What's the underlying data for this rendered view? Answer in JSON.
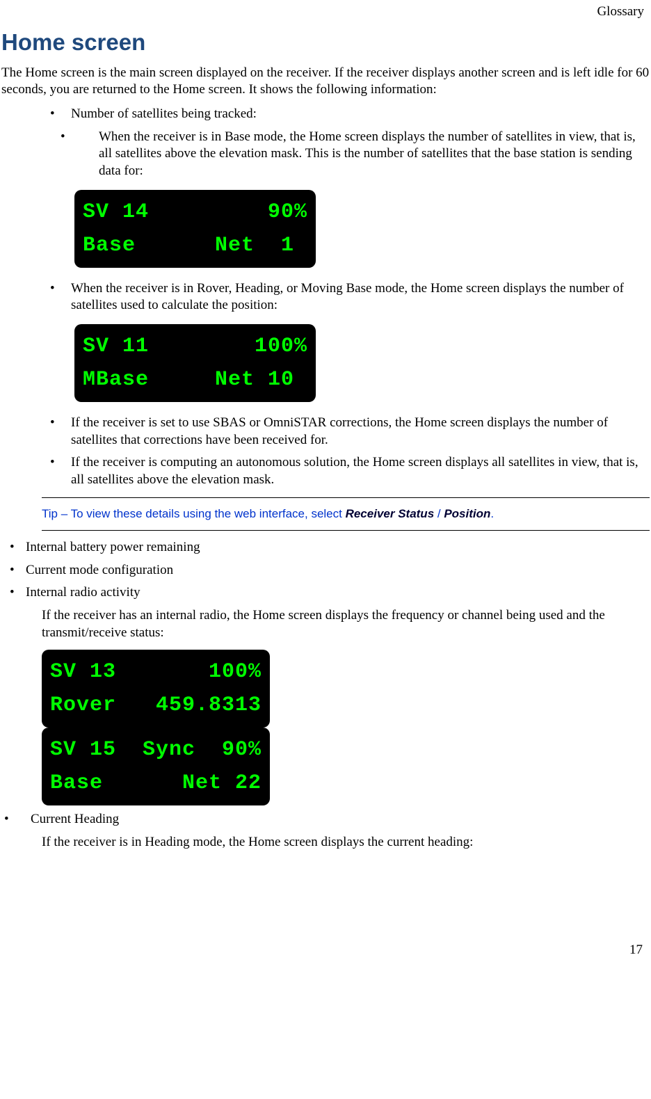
{
  "header": {
    "right": "Glossary"
  },
  "title": "Home screen",
  "intro": "The Home screen is the main screen displayed on the receiver. If the receiver displays another screen and is left idle for 60 seconds, you are returned to the Home screen. It shows the following information:",
  "bullet1": "Number of satellites being tracked:",
  "bullet1a": "When the receiver is in Base mode, the Home screen displays the number of satellites in view, that is, all satellites above the elevation mask. This is the number of satellites that the base station is sending data for:",
  "lcd1_line1": "SV 14         90%",
  "lcd1_line2": "Base      Net  1",
  "bullet2": "When the receiver is in Rover, Heading, or Moving Base mode, the Home screen displays the number of satellites used to calculate the position:",
  "lcd2_line1": "SV 11        100%",
  "lcd2_line2": "MBase     Net 10",
  "bullet3": "If the receiver is set to use SBAS or OmniSTAR corrections, the Home screen displays the number of satellites that corrections have been received for.",
  "bullet4": "If the receiver is computing an autonomous solution, the Home screen displays all satellites in view, that is, all satellites above the elevation mask.",
  "tip_prefix": "Tip – To view these details using the web interface, select ",
  "tip_b1": "Receiver Status",
  "tip_mid": " / ",
  "tip_b2": "Position",
  "tip_suffix": ".",
  "bullet5": "Internal battery power remaining",
  "bullet6": "Current mode configuration",
  "bullet7": "Internal radio activity",
  "radio_text": "If the receiver has an internal radio, the Home screen displays the frequency or channel being used and the transmit/receive status:",
  "lcd3a_line1": "SV 13       100%",
  "lcd3a_line2": "Rover   459.8313",
  "lcd3b_line1": "SV 15  Sync  90%",
  "lcd3b_line2": "Base      Net 22",
  "bullet8": "Current Heading",
  "heading_text": "If the receiver is in Heading mode, the Home screen displays the current heading:",
  "page_number": "17"
}
